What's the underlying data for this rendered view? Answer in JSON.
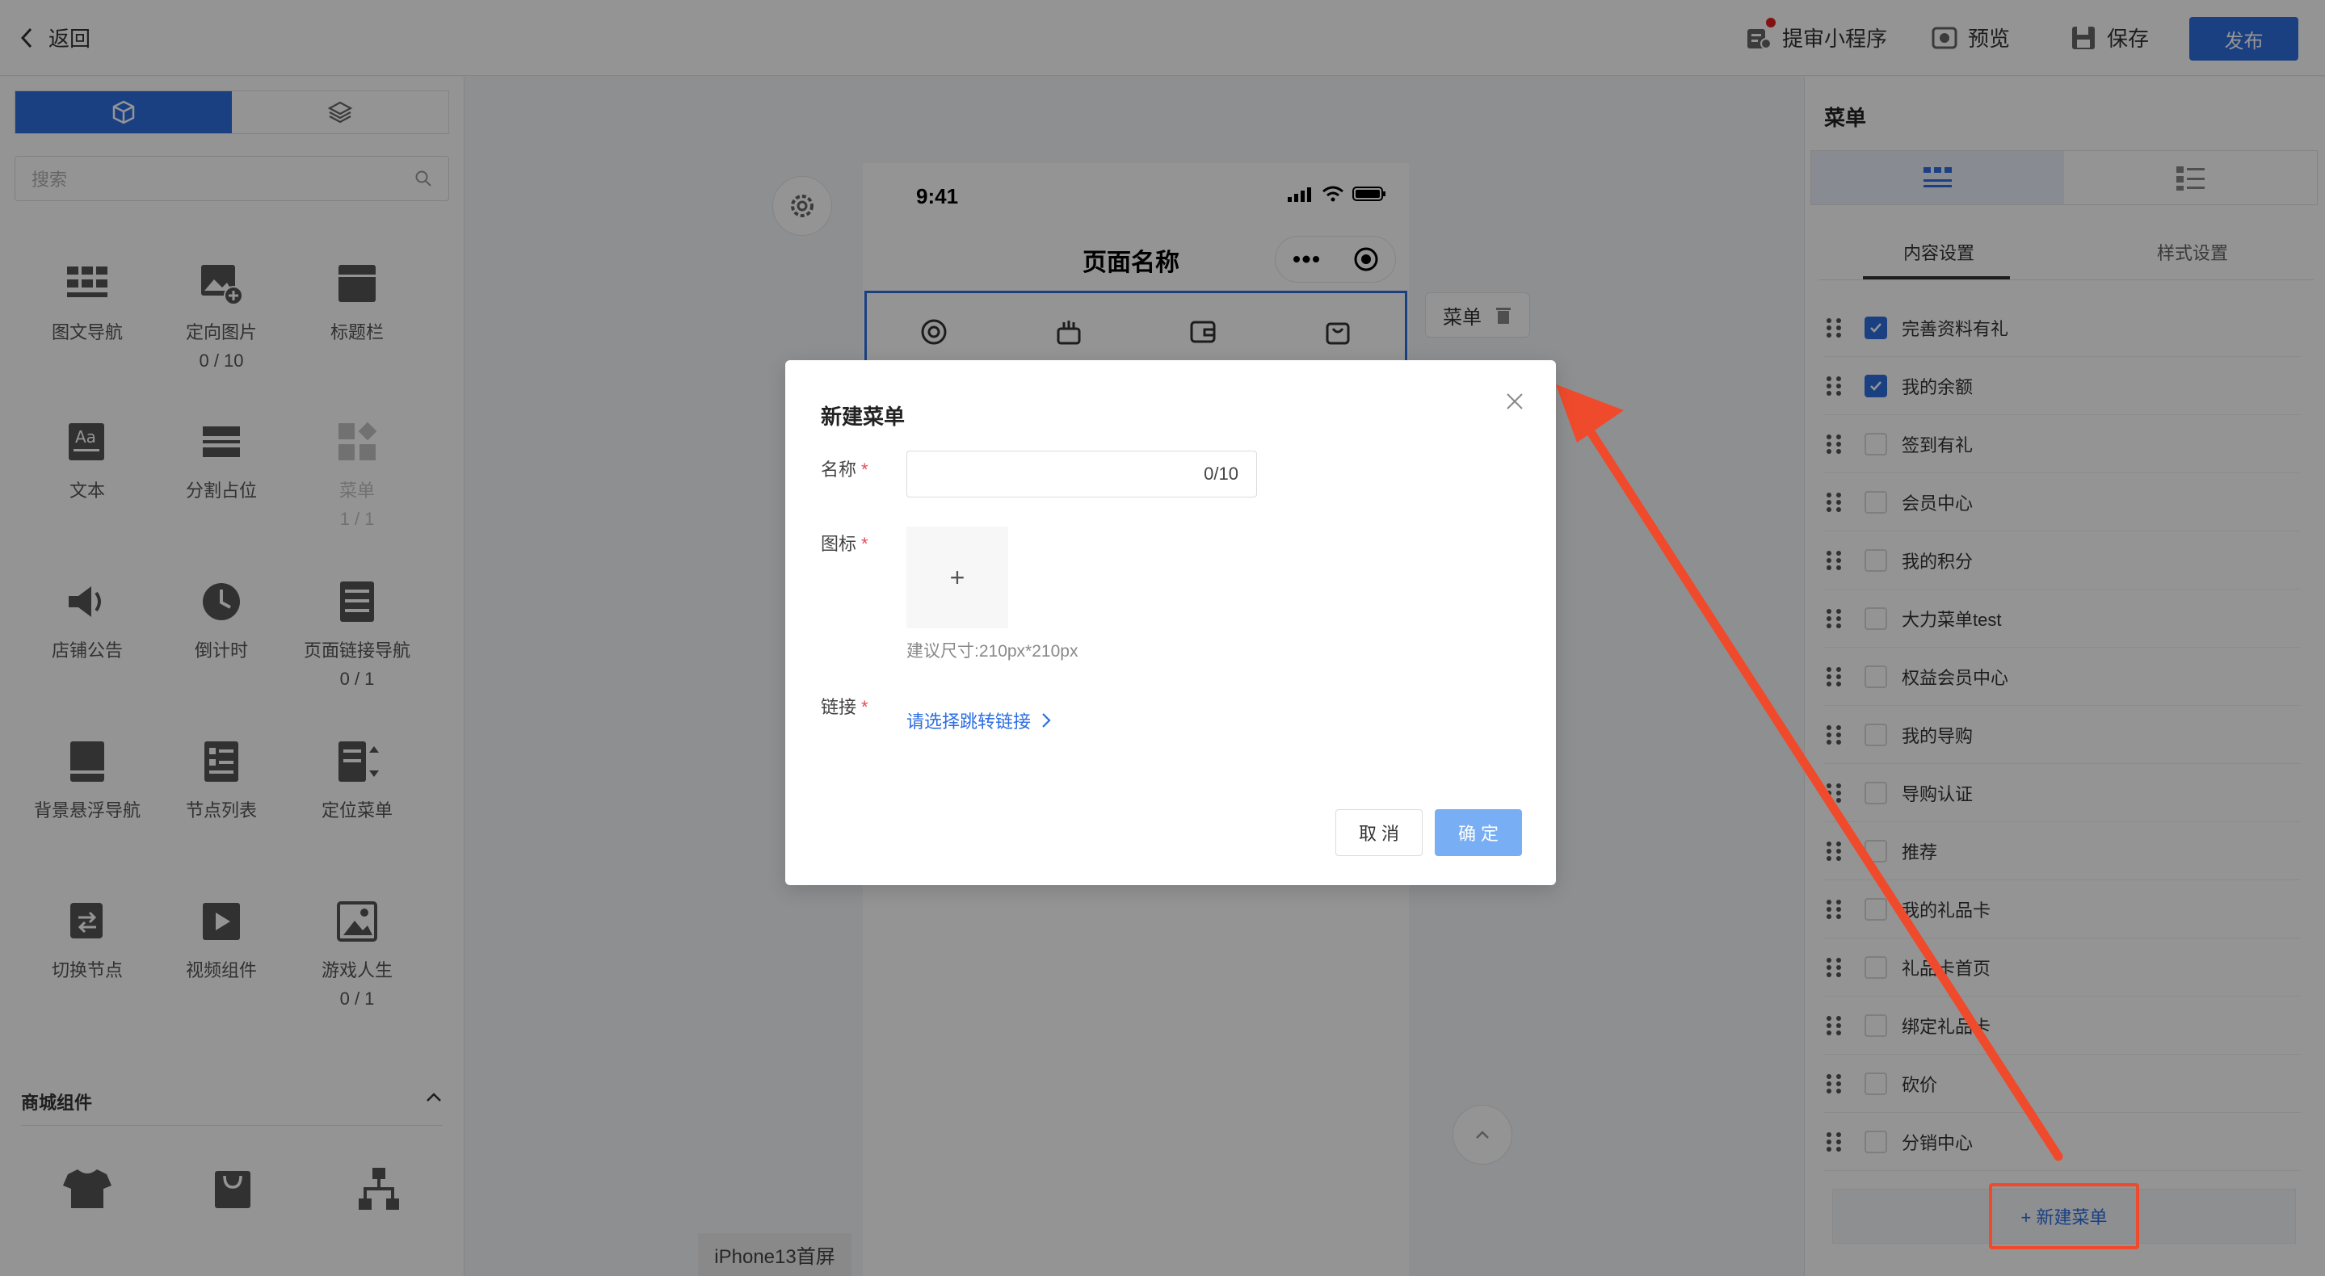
{
  "header": {
    "back_label": "返回",
    "submit_mini": "提审小程序",
    "preview": "预览",
    "save": "保存",
    "publish": "发布"
  },
  "left": {
    "search_placeholder": "搜索",
    "components": [
      {
        "label": "图文导航",
        "sub": "",
        "icon": "grid-nav-icon",
        "disabled": false
      },
      {
        "label": "定向图片",
        "sub": "0 / 10",
        "icon": "image-add-icon",
        "disabled": false
      },
      {
        "label": "标题栏",
        "sub": "",
        "icon": "title-bar-icon",
        "disabled": false
      },
      {
        "label": "文本",
        "sub": "",
        "icon": "text-icon",
        "disabled": false
      },
      {
        "label": "分割占位",
        "sub": "",
        "icon": "divider-icon",
        "disabled": false
      },
      {
        "label": "菜单",
        "sub": "1 / 1",
        "icon": "menu-grid-icon",
        "disabled": true
      },
      {
        "label": "店铺公告",
        "sub": "",
        "icon": "speaker-icon",
        "disabled": false
      },
      {
        "label": "倒计时",
        "sub": "",
        "icon": "clock-icon",
        "disabled": false
      },
      {
        "label": "页面链接导航",
        "sub": "0 / 1",
        "icon": "page-link-icon",
        "disabled": false
      },
      {
        "label": "背景悬浮导航",
        "sub": "",
        "icon": "float-nav-icon",
        "disabled": false
      },
      {
        "label": "节点列表",
        "sub": "",
        "icon": "node-list-icon",
        "disabled": false
      },
      {
        "label": "定位菜单",
        "sub": "",
        "icon": "anchor-menu-icon",
        "disabled": false
      },
      {
        "label": "切换节点",
        "sub": "",
        "icon": "switch-node-icon",
        "disabled": false
      },
      {
        "label": "视频组件",
        "sub": "",
        "icon": "video-icon",
        "disabled": false
      },
      {
        "label": "游戏人生",
        "sub": "0 / 1",
        "icon": "game-icon",
        "disabled": false
      }
    ],
    "mall_section": "商城组件"
  },
  "canvas": {
    "time": "9:41",
    "page_name": "页面名称",
    "menu_tag": "菜单",
    "screen_label": "iPhone13首屏"
  },
  "right": {
    "title": "菜单",
    "tab_content": "内容设置",
    "tab_style": "样式设置",
    "items": [
      {
        "label": "完善资料有礼",
        "checked": true
      },
      {
        "label": "我的余额",
        "checked": true
      },
      {
        "label": "签到有礼",
        "checked": false
      },
      {
        "label": "会员中心",
        "checked": false
      },
      {
        "label": "我的积分",
        "checked": false
      },
      {
        "label": "大力菜单test",
        "checked": false
      },
      {
        "label": "权益会员中心",
        "checked": false
      },
      {
        "label": "我的导购",
        "checked": false
      },
      {
        "label": "导购认证",
        "checked": false
      },
      {
        "label": "推荐",
        "checked": false
      },
      {
        "label": "我的礼品卡",
        "checked": false
      },
      {
        "label": "礼品卡首页",
        "checked": false
      },
      {
        "label": "绑定礼品卡",
        "checked": false
      },
      {
        "label": "砍价",
        "checked": false
      },
      {
        "label": "分销中心",
        "checked": false
      }
    ],
    "new_menu": "+ 新建菜单"
  },
  "dialog": {
    "title": "新建菜单",
    "name_label": "名称",
    "name_count": "0/10",
    "icon_label": "图标",
    "upload_plus": "+",
    "icon_hint": "建议尺寸:210px*210px",
    "link_label": "链接",
    "link_pick": "请选择跳转链接",
    "required_mark": "*",
    "cancel": "取 消",
    "ok": "确 定"
  },
  "colors": {
    "accent": "#2d6ee0",
    "annotation": "#f04a2c"
  }
}
